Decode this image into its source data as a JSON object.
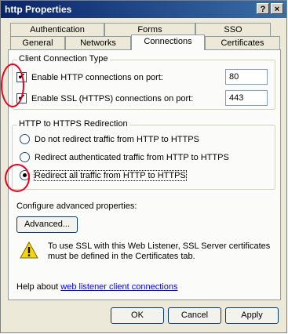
{
  "window": {
    "title": "http Properties",
    "help_button": "?",
    "close_button": "×"
  },
  "tabs_row1": [
    "Authentication",
    "Forms",
    "SSO"
  ],
  "tabs_row2": [
    "General",
    "Networks",
    "Connections",
    "Certificates"
  ],
  "client_connection": {
    "group_title": "Client Connection Type",
    "http": {
      "label": "Enable HTTP connections on port:",
      "checked": true,
      "port": "80"
    },
    "https": {
      "label": "Enable SSL (HTTPS) connections on port:",
      "checked": true,
      "port": "443"
    }
  },
  "redirection": {
    "group_title": "HTTP to HTTPS Redirection",
    "options": [
      {
        "label": "Do not redirect traffic from HTTP to HTTPS",
        "selected": false
      },
      {
        "label": "Redirect authenticated traffic from HTTP to HTTPS",
        "selected": false
      },
      {
        "label": "Redirect all traffic from HTTP to HTTPS",
        "selected": true
      }
    ]
  },
  "advanced": {
    "label": "Configure advanced properties:",
    "button": "Advanced..."
  },
  "warning": {
    "icon": "warning-icon",
    "text": "To use SSL with this Web Listener, SSL Server certificates must be defined in the Certificates tab."
  },
  "help": {
    "prefix": "Help about ",
    "link": "web listener client connections"
  },
  "buttons": {
    "ok": "OK",
    "cancel": "Cancel",
    "apply": "Apply"
  },
  "colors": {
    "title_bar": "#0a246a",
    "annotation": "#e8001c",
    "link": "#0000ff"
  }
}
